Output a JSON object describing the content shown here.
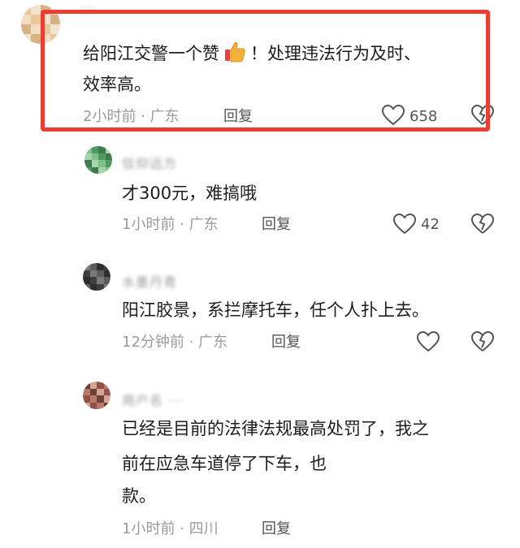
{
  "comments": [
    {
      "name": "···",
      "text_before_emoji": "给阳江交警一个赞",
      "text_after_emoji": "！处理违法行为及时、",
      "text_line2": "效率高。",
      "time_location": "2小时前 · 广东",
      "reply": "回复",
      "likes": "658",
      "avatar_colors": [
        "#e9c99a",
        "#f3dcc0",
        "#d8b184",
        "#f0e3cf"
      ]
    },
    {
      "name": "信仰远方",
      "text": "才300元，难搞哦",
      "time_location": "1小时前 · 广东",
      "reply": "回复",
      "likes": "42",
      "avatar_colors": [
        "#4f9a61",
        "#7fc08a",
        "#a6d3ae",
        "#3d7a4c"
      ]
    },
    {
      "name": "水墨丹青",
      "text": "阳江胶景，系拦摩托车，任个人扑上去。",
      "time_location": "12分钟前 · 广东",
      "reply": "回复",
      "avatar_colors": [
        "#2e2e2e",
        "#5b5b5b",
        "#7a7a7a",
        "#3f3f3f"
      ]
    },
    {
      "name": "用户名 ···",
      "text_line1": "已经是目前的法律法规最高处罚了，我之",
      "text_line2": "前在应急车道停了下车，也",
      "text_line3": "款。",
      "time_location": "1小时前 · 四川",
      "reply": "回复",
      "avatar_colors": [
        "#b77a6b",
        "#8e5446",
        "#d4a596",
        "#6d3e33"
      ]
    }
  ],
  "colors": {
    "highlight": "#ea3e33",
    "meta": "#9b9b9b",
    "text": "#1c1c1c",
    "emoji_thumb": "#f2b23a",
    "emoji_bg": "#e8423b"
  }
}
